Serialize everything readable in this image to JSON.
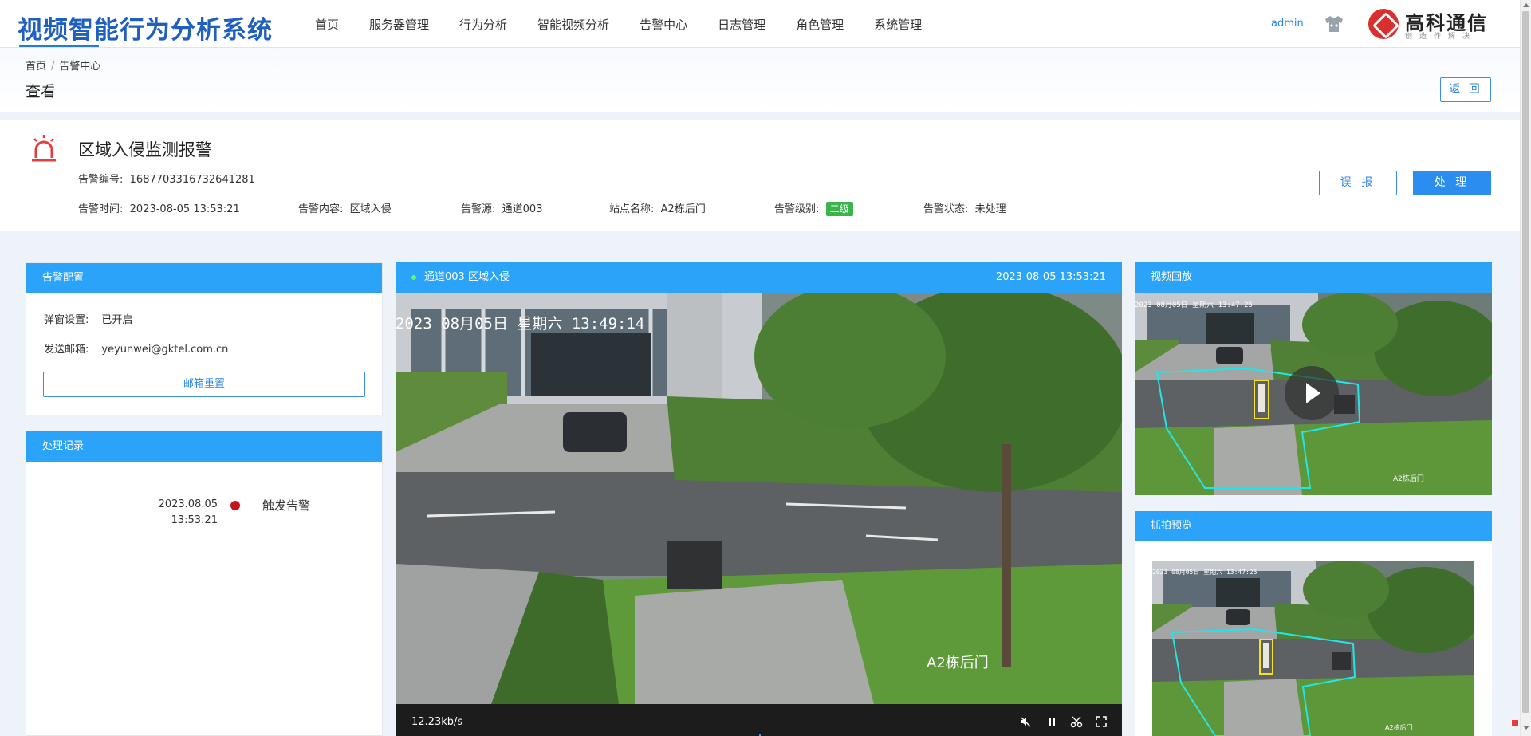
{
  "app": {
    "title": "视频智能行为分析系统",
    "user": "admin",
    "logo_name": "高科通信",
    "logo_slogan": "创造作解决"
  },
  "nav": [
    "首页",
    "服务器管理",
    "行为分析",
    "智能视频分析",
    "告警中心",
    "日志管理",
    "角色管理",
    "系统管理"
  ],
  "breadcrumb": {
    "home": "首页",
    "sep": "/",
    "current": "告警中心"
  },
  "page": {
    "title": "查看",
    "back": "返 回"
  },
  "alarm": {
    "title": "区域入侵监测报警",
    "id_label": "告警编号:",
    "id_value": "1687703316732641281",
    "time_label": "告警时间:",
    "time_value": "2023-08-05 13:53:21",
    "content_label": "告警内容:",
    "content_value": "区域入侵",
    "source_label": "告警源:",
    "source_value": "通道003",
    "site_label": "站点名称:",
    "site_value": "A2栋后门",
    "level_label": "告警级别:",
    "level_value": "二级",
    "status_label": "告警状态:",
    "status_value": "未处理",
    "report_btn": "误 报",
    "handle_btn": "处 理",
    "level_color": "#3ab54a",
    "icon_color": "#e53c3c"
  },
  "config": {
    "title": "告警配置",
    "popup_label": "弹窗设置:",
    "popup_value": "已开启",
    "email_label": "发送邮箱:",
    "email_value": "yeyunwei@gktel.com.cn",
    "reset_btn": "邮箱重置"
  },
  "records": {
    "title": "处理记录",
    "items": [
      {
        "date": "2023.08.05",
        "time": "13:53:21",
        "text": "触发告警"
      }
    ]
  },
  "video": {
    "title": "通道003 区域入侵",
    "time": "2023-08-05 13:53:21",
    "osd_time": "2023 08月05日 星期六 13:49:14",
    "osd_site": "A2栋后门",
    "bitrate": "12.23kb/s",
    "controls": [
      "mute-icon",
      "pause-icon",
      "scissors-icon",
      "fullscreen-icon"
    ]
  },
  "playback": {
    "title": "视频回放",
    "osd_time": "2023 08月05日 星期六 13:47:25",
    "osd_site": "A2栋后门"
  },
  "snapshot": {
    "title": "抓拍预览",
    "osd_time": "2023 08月05日 星期六 13:47:25",
    "osd_site": "A2栋后门"
  },
  "colors": {
    "accent": "#2aa3f8",
    "primary": "#2b8df0",
    "brand": "#1f5fc0"
  }
}
